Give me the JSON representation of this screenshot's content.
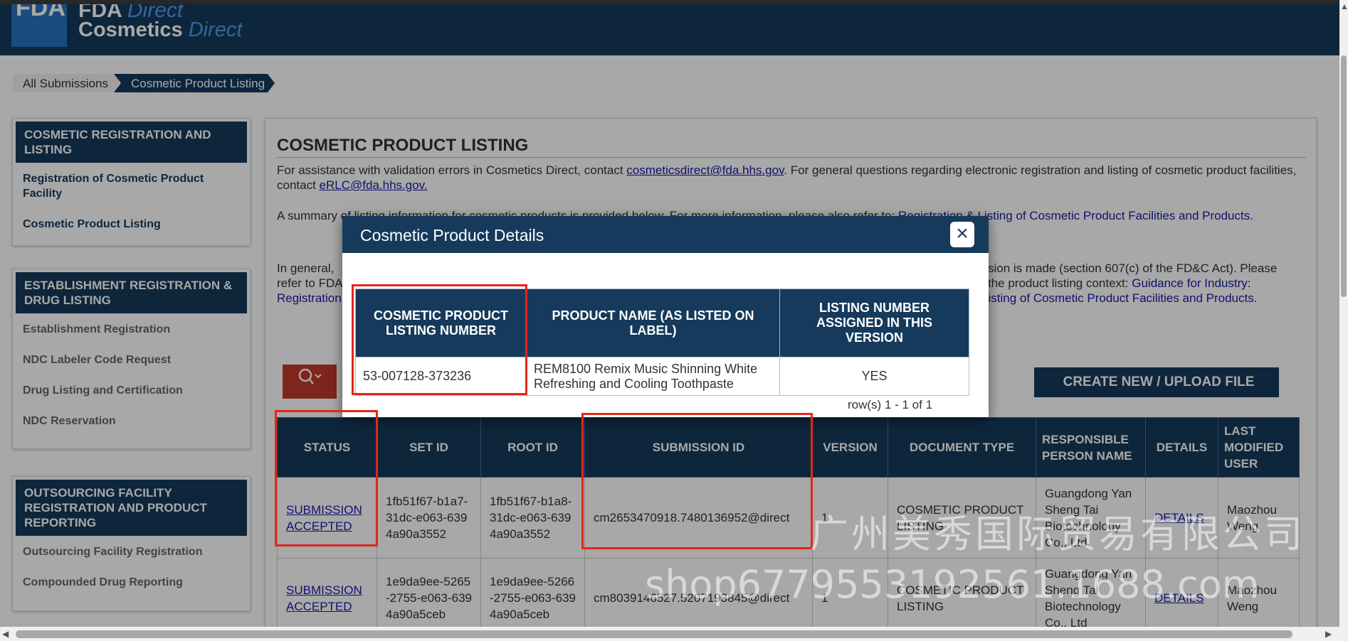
{
  "header": {
    "logo_small": "FDA",
    "product_top": "FDA",
    "product_top_italic": "Direct",
    "product_name": "Cosmetics",
    "product_name_italic": "Direct"
  },
  "breadcrumb": {
    "all": "All Submissions",
    "current": "Cosmetic Product Listing"
  },
  "sidebar": {
    "sections": [
      {
        "title": "COSMETIC REGISTRATION AND LISTING",
        "items": [
          "Registration of Cosmetic Product Facility",
          "Cosmetic Product Listing"
        ]
      },
      {
        "title": "ESTABLISHMENT REGISTRATION & DRUG LISTING",
        "items": [
          "Establishment Registration",
          "NDC Labeler Code Request",
          "Drug Listing and Certification",
          "NDC Reservation"
        ]
      },
      {
        "title": "OUTSOURCING FACILITY REGISTRATION AND PRODUCT REPORTING",
        "items": [
          "Outsourcing Facility Registration",
          "Compounded Drug Reporting"
        ]
      }
    ]
  },
  "main": {
    "title": "COSMETIC PRODUCT LISTING",
    "p1_a": "For assistance with validation errors in Cosmetics Direct, contact ",
    "p1_link1": "cosmeticsdirect@fda.hhs.gov",
    "p1_b": ". For general questions regarding electronic registration and listing of cosmetic product facilities, contact ",
    "p1_link2": "eRLC@fda.hhs.gov.",
    "p2_a": "A summary of listing information for cosmetic products is provided below. For more information, please also refer to: ",
    "p2_link": "Registration & Listing of Cosmetic Product Facilities and Products.",
    "p3_left1": "In general,",
    "p3_left2": "refer to FDA",
    "p3_left3": "Registration",
    "p3_right1": "sion is made (section 607(c) of the FD&C Act). Please",
    "p3_right2a": "the product listing context: ",
    "p3_right2b": "Guidance for Industry:",
    "p3_right3": "& Listing of Cosmetic Product Facilities and Products.",
    "create_button": "CREATE NEW / UPLOAD FILE",
    "table": {
      "headers": [
        "STATUS",
        "SET ID",
        "ROOT ID",
        "SUBMISSION ID",
        "VERSION",
        "DOCUMENT TYPE",
        "RESPONSIBLE PERSON NAME",
        "DETAILS",
        "LAST MODIFIED USER"
      ],
      "rows": [
        {
          "status": "SUBMISSION ACCEPTED",
          "set_id": "1fb51f67-b1a7-31dc-e063-6394a90a3552",
          "root_id": "1fb51f67-b1a8-31dc-e063-6394a90a3552",
          "submission_id": "cm2653470918.7480136952@direct",
          "version": "1",
          "doc_type": "COSMETIC PRODUCT LISTING",
          "person": "Guangdong Yan Sheng Tai Biotechnology Co., Ltd",
          "details": "DETAILS",
          "user": "Maozhou Weng"
        },
        {
          "status": "SUBMISSION ACCEPTED",
          "set_id": "1e9da9ee-5265-2755-e063-6394a90a5ceb",
          "root_id": "1e9da9ee-5266-2755-e063-6394a90a5ceb",
          "submission_id": "cm8039146527.5207193845@direct",
          "version": "1",
          "doc_type": "COSMETIC PRODUCT LISTING",
          "person": "Guangdong Yan Sheng Tai Biotechnology Co., Ltd",
          "details": "DETAILS",
          "user": "Maozhou Weng"
        }
      ]
    }
  },
  "modal": {
    "title": "Cosmetic Product Details",
    "close": "×",
    "headers": [
      "COSMETIC PRODUCT LISTING NUMBER",
      "PRODUCT NAME (AS LISTED ON LABEL)",
      "LISTING NUMBER ASSIGNED IN THIS VERSION"
    ],
    "row": {
      "listing_number": "53-007128-373236",
      "product_name": "REM8100 Remix Music Shinning White Refreshing and Cooling Toothpaste",
      "assigned": "YES"
    },
    "rows_info": "row(s) 1 - 1 of 1"
  },
  "watermark": {
    "line1": "广州美秀国际贸易有限公司",
    "line2": "shop6779553192561.1688.com"
  },
  "icons": {
    "search": "search-icon",
    "close": "close-icon"
  },
  "colors": {
    "navy": "#163a5c",
    "red_highlight": "#e3261b",
    "search_red": "#c0392b"
  }
}
